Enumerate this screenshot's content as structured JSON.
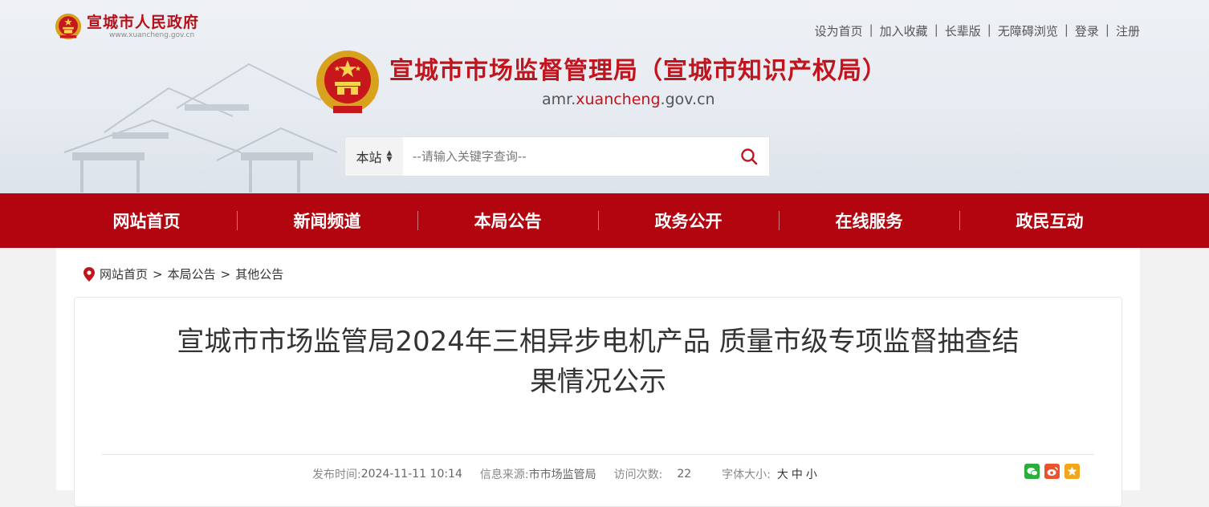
{
  "header": {
    "gov_name": "宣城市人民政府",
    "gov_url": "www.xuancheng.gov.cn",
    "site_title": "宣城市市场监督管理局（宣城市知识产权局）",
    "site_domain_prefix": "amr.",
    "site_domain_main": "xuancheng",
    "site_domain_suffix": ".gov.cn",
    "top_links": [
      "设为首页",
      "加入收藏",
      "长辈版",
      "无障碍浏览",
      "登录",
      "注册"
    ],
    "separator": "|"
  },
  "search": {
    "scope": "本站",
    "placeholder": "--请输入关键字查询--"
  },
  "nav": {
    "items": [
      "网站首页",
      "新闻频道",
      "本局公告",
      "政务公开",
      "在线服务",
      "政民互动"
    ]
  },
  "breadcrumb": {
    "items": [
      "网站首页",
      "本局公告",
      "其他公告"
    ],
    "separator": ">"
  },
  "article": {
    "title": "宣城市市场监管局2024年三相异步电机产品 质量市级专项监督抽查结果情况公示",
    "publish_label": "发布时间:",
    "publish_time": "2024-11-11 10:14",
    "source_label": "信息来源:",
    "source": "市市场监管局",
    "visits_label": "访问次数:",
    "visits": "22",
    "fontsize_label": "字体大小:",
    "fontsize_options": [
      "大",
      "中",
      "小"
    ]
  },
  "colors": {
    "brand_red": "#b3050f",
    "title_red": "#c0151e"
  },
  "icons": {
    "search": "search-icon",
    "location": "location-pin-icon",
    "share": [
      "wechat-icon",
      "weibo-icon",
      "favorite-icon"
    ]
  }
}
